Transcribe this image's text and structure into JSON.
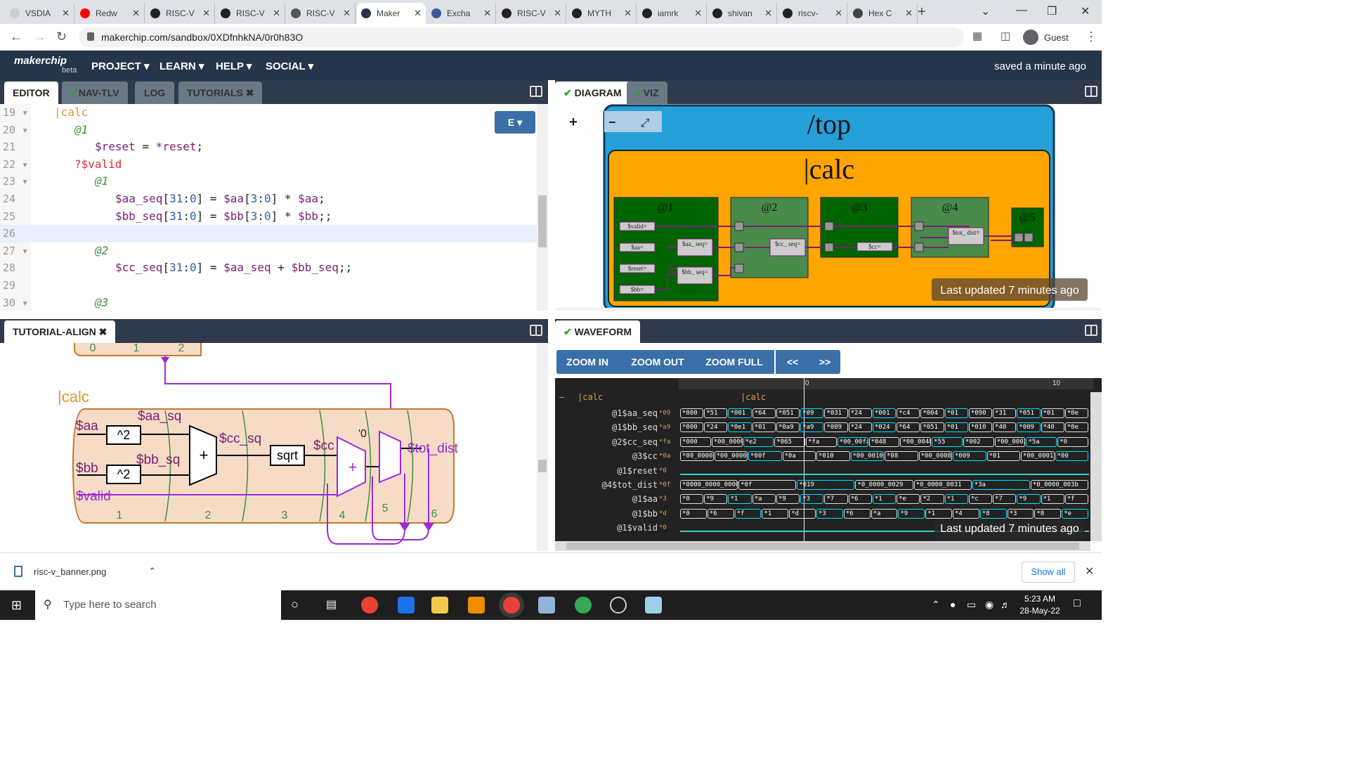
{
  "browser": {
    "tabs": [
      {
        "title": "VSDIA",
        "favicon_color": "#cccccc"
      },
      {
        "title": "Redw",
        "favicon_color": "#ff0000"
      },
      {
        "title": "RISC-V",
        "favicon_color": "#222222"
      },
      {
        "title": "RISC-V",
        "favicon_color": "#222222"
      },
      {
        "title": "RISC-V",
        "favicon_color": "#555555"
      },
      {
        "title": "Maker",
        "favicon_color": "#26364a"
      },
      {
        "title": "Excha",
        "favicon_color": "#3b5998"
      },
      {
        "title": "RISC-V",
        "favicon_color": "#222222"
      },
      {
        "title": "MYTH",
        "favicon_color": "#222222"
      },
      {
        "title": "iamrk",
        "favicon_color": "#222222"
      },
      {
        "title": "shivan",
        "favicon_color": "#222222"
      },
      {
        "title": "riscv-",
        "favicon_color": "#222222"
      },
      {
        "title": "Hex C",
        "favicon_color": "#444444"
      }
    ],
    "active_tab": 5,
    "url": "makerchip.com/sandbox/0XDfnhkNA/0r0h83O",
    "profile_label": "Guest"
  },
  "makerchip": {
    "logo": "makerchip",
    "beta": "beta",
    "menus": [
      "PROJECT",
      "LEARN",
      "HELP",
      "SOCIAL"
    ],
    "saved_status": "saved a minute ago"
  },
  "editor_tabs": [
    "EDITOR",
    "NAV-TLV",
    "LOG",
    "TUTORIALS"
  ],
  "editor_button": "E",
  "code_lines": [
    {
      "n": "19",
      "fold": true,
      "tokens": [
        {
          "t": "|calc",
          "c": "c-pipe"
        }
      ],
      "indent": 2
    },
    {
      "n": "20",
      "fold": true,
      "tokens": [
        {
          "t": "@1",
          "c": "c-stage"
        }
      ],
      "indent": 4
    },
    {
      "n": "21",
      "fold": false,
      "tokens": [
        {
          "t": "$reset",
          "c": "c-sig"
        },
        {
          "t": " = ",
          "c": "c-plain"
        },
        {
          "t": "*reset",
          "c": "c-sig"
        },
        {
          "t": ";",
          "c": "c-plain"
        }
      ],
      "indent": 6
    },
    {
      "n": "22",
      "fold": true,
      "tokens": [
        {
          "t": "?$valid",
          "c": "c-when"
        }
      ],
      "indent": 4
    },
    {
      "n": "23",
      "fold": true,
      "tokens": [
        {
          "t": "@1",
          "c": "c-stage"
        }
      ],
      "indent": 6
    },
    {
      "n": "24",
      "fold": false,
      "tokens": [
        {
          "t": "$aa_seq",
          "c": "c-sig"
        },
        {
          "t": "[",
          "c": "c-plain"
        },
        {
          "t": "31",
          "c": "c-num"
        },
        {
          "t": ":",
          "c": "c-plain"
        },
        {
          "t": "0",
          "c": "c-num"
        },
        {
          "t": "] = ",
          "c": "c-plain"
        },
        {
          "t": "$aa",
          "c": "c-sig"
        },
        {
          "t": "[",
          "c": "c-plain"
        },
        {
          "t": "3",
          "c": "c-num"
        },
        {
          "t": ":",
          "c": "c-plain"
        },
        {
          "t": "0",
          "c": "c-num"
        },
        {
          "t": "] * ",
          "c": "c-plain"
        },
        {
          "t": "$aa",
          "c": "c-sig"
        },
        {
          "t": ";",
          "c": "c-plain"
        }
      ],
      "indent": 8
    },
    {
      "n": "25",
      "fold": false,
      "tokens": [
        {
          "t": "$bb_seq",
          "c": "c-sig"
        },
        {
          "t": "[",
          "c": "c-plain"
        },
        {
          "t": "31",
          "c": "c-num"
        },
        {
          "t": ":",
          "c": "c-plain"
        },
        {
          "t": "0",
          "c": "c-num"
        },
        {
          "t": "] = ",
          "c": "c-plain"
        },
        {
          "t": "$bb",
          "c": "c-sig"
        },
        {
          "t": "[",
          "c": "c-plain"
        },
        {
          "t": "3",
          "c": "c-num"
        },
        {
          "t": ":",
          "c": "c-plain"
        },
        {
          "t": "0",
          "c": "c-num"
        },
        {
          "t": "] * ",
          "c": "c-plain"
        },
        {
          "t": "$bb",
          "c": "c-sig"
        },
        {
          "t": ";;",
          "c": "c-plain"
        }
      ],
      "indent": 8
    },
    {
      "n": "26",
      "fold": false,
      "tokens": [],
      "indent": 0
    },
    {
      "n": "27",
      "fold": true,
      "tokens": [
        {
          "t": "@2",
          "c": "c-stage"
        }
      ],
      "indent": 6
    },
    {
      "n": "28",
      "fold": false,
      "tokens": [
        {
          "t": "$cc_seq",
          "c": "c-sig"
        },
        {
          "t": "[",
          "c": "c-plain"
        },
        {
          "t": "31",
          "c": "c-num"
        },
        {
          "t": ":",
          "c": "c-plain"
        },
        {
          "t": "0",
          "c": "c-num"
        },
        {
          "t": "] = ",
          "c": "c-plain"
        },
        {
          "t": "$aa_seq",
          "c": "c-sig"
        },
        {
          "t": " + ",
          "c": "c-plain"
        },
        {
          "t": "$bb_seq",
          "c": "c-sig"
        },
        {
          "t": ";;",
          "c": "c-plain"
        }
      ],
      "indent": 8
    },
    {
      "n": "29",
      "fold": false,
      "tokens": [],
      "indent": 0
    },
    {
      "n": "30",
      "fold": true,
      "tokens": [
        {
          "t": "@3",
          "c": "c-stage"
        }
      ],
      "indent": 6
    }
  ],
  "right_tabs": [
    "DIAGRAM",
    "VIZ"
  ],
  "diagram": {
    "top_label": "/top",
    "calc_label": "|calc",
    "stages": [
      "@1",
      "@2",
      "@3",
      "@4",
      "@5"
    ],
    "signals": [
      "$valid=",
      "$aa=",
      "$reset=",
      "$bb=",
      "$aa_\nseq=",
      "$bb_\nseq=",
      "$cc_\nseq=",
      "$cc=",
      "$tot_\ndist="
    ],
    "updated": "Last updated 7 minutes ago",
    "zoom_in": "+",
    "zoom_out": "−",
    "fit": "⤢"
  },
  "tutorial": {
    "tab": "TUTORIAL-ALIGN",
    "pipe_label": "|calc",
    "top_stages": [
      "0",
      "1",
      "2"
    ],
    "stage_numbers": [
      "1",
      "2",
      "3",
      "4",
      "5",
      "6"
    ],
    "labels": {
      "aa": "$aa",
      "bb": "$bb",
      "aa_sq": "$aa_sq",
      "bb_sq": "$bb_sq",
      "cc_sq": "$cc_sq",
      "cc": "$cc",
      "valid": "$valid",
      "tot_dist": "$tot_dist",
      "sq1": "^2",
      "sq2": "^2",
      "sqrt": "sqrt",
      "plus": "+",
      "zero": "'0"
    }
  },
  "waveform": {
    "tab": "WAVEFORM",
    "buttons": [
      "ZOOM IN",
      "ZOOM OUT",
      "ZOOM FULL",
      "<<",
      ">>"
    ],
    "ruler": [
      "0",
      "10"
    ],
    "scope_label": "|calc",
    "scope_label_right": "|calc",
    "updated": "Last updated 7 minutes ago",
    "signals": [
      {
        "name": "@1$aa_seq",
        "init": "09",
        "values": [
          "000",
          "51",
          "001",
          "64",
          "051",
          "09",
          "031",
          "24",
          "001",
          "c4",
          "004",
          "01",
          "090",
          "31",
          "051",
          "01",
          "0e"
        ]
      },
      {
        "name": "@1$bb_seq",
        "init": "a9",
        "values": [
          "000",
          "24",
          "0e1",
          "01",
          "0a9",
          "a9",
          "009",
          "24",
          "024",
          "64",
          "051",
          "01",
          "010",
          "40",
          "009",
          "40",
          "0e"
        ]
      },
      {
        "name": "@2$cc_seq",
        "init": "fa",
        "values": [
          "000",
          "00_0000",
          "e2",
          "065",
          "fa",
          "00_00fa",
          "048",
          "00_0048",
          "55",
          "002",
          "00_0002",
          "5a",
          "0"
        ]
      },
      {
        "name": "@3$cc",
        "init": "0a",
        "values": [
          "00_0000",
          "00_0000",
          "00f",
          "0a",
          "010",
          "00_0010",
          "08",
          "00_0008",
          "009",
          "01",
          "00_0001",
          "00"
        ]
      },
      {
        "name": "@1$reset",
        "init": "0",
        "values": []
      },
      {
        "name": "@4$tot_dist",
        "init": "0f",
        "values": [
          "0000_0000_0000_0000",
          "0f",
          "019",
          "0_0000_0029",
          "0_0000_0031",
          "3a",
          "0_0000_003b"
        ]
      },
      {
        "name": "@1$aa",
        "init": "3",
        "values": [
          "0",
          "9",
          "1",
          "a",
          "9",
          "3",
          "7",
          "6",
          "1",
          "e",
          "2",
          "1",
          "c",
          "7",
          "9",
          "1",
          "f"
        ]
      },
      {
        "name": "@1$bb",
        "init": "d",
        "values": [
          "0",
          "6",
          "f",
          "1",
          "d",
          "3",
          "6",
          "a",
          "9",
          "1",
          "4",
          "8",
          "3",
          "8",
          "e"
        ]
      },
      {
        "name": "@1$valid",
        "init": "0",
        "values": []
      }
    ]
  },
  "downloads": {
    "file": "risc-v_banner.png",
    "show_all": "Show all"
  },
  "taskbar": {
    "search": "Type here to search",
    "time": "5:23 AM",
    "date": "28-May-22"
  }
}
